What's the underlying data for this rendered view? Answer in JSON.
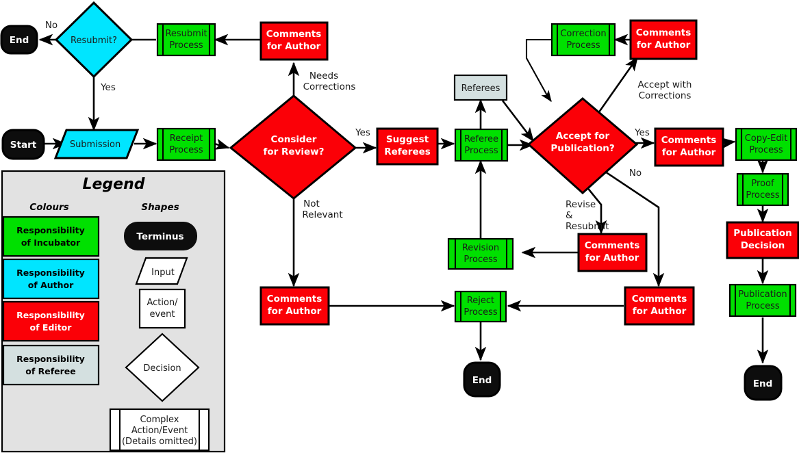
{
  "diagram": {
    "title": "Journal submission and review workflow flowchart",
    "colors": {
      "incubator_green": "#00e000",
      "author_cyan": "#00e5ff",
      "editor_red": "#fb0007",
      "referee_grey": "#d4e0e0",
      "terminus_black": "#0d0d0d",
      "legend_bg": "#e2e2e2",
      "stroke": "#000000",
      "white": "#ffffff"
    },
    "nodes": {
      "end_left": "End",
      "resubmit_decision": "Resubmit?",
      "resubmit_process_l1": "Resubmit",
      "resubmit_process_l2": "Process",
      "comments_top_l1": "Comments",
      "comments_top_l2": "for Author",
      "start": "Start",
      "submission": "Submission",
      "receipt_process_l1": "Receipt",
      "receipt_process_l2": "Process",
      "consider_l1": "Consider",
      "consider_l2": "for Review?",
      "suggest_l1": "Suggest",
      "suggest_l2": "Referees",
      "referees": "Referees",
      "referee_process_l1": "Referee",
      "referee_process_l2": "Process",
      "accept_l1": "Accept for",
      "accept_l2": "Publication?",
      "correction_process_l1": "Correction",
      "correction_process_l2": "Process",
      "comments_corr_l1": "Comments",
      "comments_corr_l2": "for Author",
      "comments_yes_l1": "Comments",
      "comments_yes_l2": "for Author",
      "copyedit_l1": "Copy-Edit",
      "copyedit_l2": "Process",
      "proof_l1": "Proof",
      "proof_l2": "Process",
      "pubdecision_l1": "Publication",
      "pubdecision_l2": "Decision",
      "pubprocess_l1": "Publication",
      "pubprocess_l2": "Process",
      "end_right": "End",
      "revision_l1": "Revision",
      "revision_l2": "Process",
      "comments_revise_l1": "Comments",
      "comments_revise_l2": "for Author",
      "comments_notrelevant_l1": "Comments",
      "comments_notrelevant_l2": "for Author",
      "comments_no_l1": "Comments",
      "comments_no_l2": "for Author",
      "reject_l1": "Reject",
      "reject_l2": "Process",
      "end_middle": "End"
    },
    "edge_labels": {
      "no_resubmit": "No",
      "yes_resubmit": "Yes",
      "needs_corrections_l1": "Needs",
      "needs_corrections_l2": "Corrections",
      "yes_consider": "Yes",
      "not_relevant_l1": "Not",
      "not_relevant_l2": "Relevant",
      "accept_with_l1": "Accept with",
      "accept_with_l2": "Corrections",
      "yes_accept": "Yes",
      "no_accept": "No",
      "revise_l1": "Revise",
      "revise_l2": "&",
      "revise_l3": "Resubmit"
    }
  },
  "legend": {
    "title": "Legend",
    "colours_heading": "Colours",
    "shapes_heading": "Shapes",
    "colours": [
      {
        "l1": "Responsibility",
        "l2": "of Incubator",
        "fill": "#00e000",
        "text": "#000000"
      },
      {
        "l1": "Responsibility",
        "l2": "of Author",
        "fill": "#00e5ff",
        "text": "#000000"
      },
      {
        "l1": "Responsibility",
        "l2": "of Editor",
        "fill": "#fb0007",
        "text": "#ffffff"
      },
      {
        "l1": "Responsibility",
        "l2": "of Referee",
        "fill": "#d4e0e0",
        "text": "#000000"
      }
    ],
    "shapes": {
      "terminus": "Terminus",
      "input": "Input",
      "action_l1": "Action/",
      "action_l2": "event",
      "decision": "Decision",
      "complex_l1": "Complex",
      "complex_l2": "Action/Event",
      "complex_l3": "(Details omitted)"
    }
  }
}
